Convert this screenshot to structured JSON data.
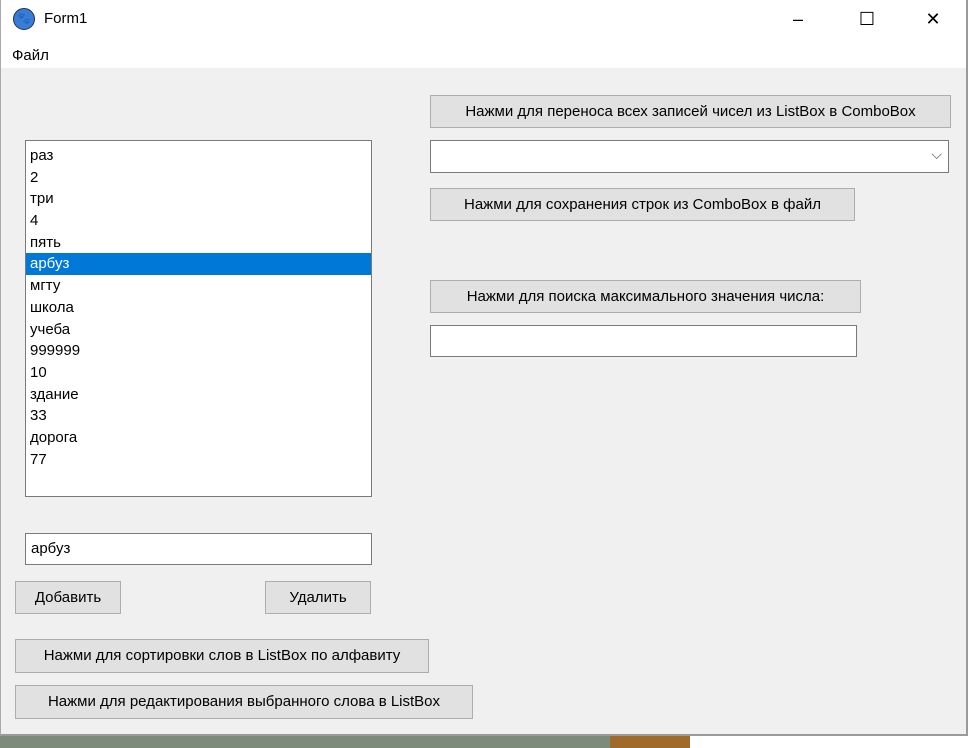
{
  "window": {
    "title": "Form1",
    "minimize": "–",
    "maximize": "☐",
    "close": "✕"
  },
  "menu": {
    "file": "Файл"
  },
  "listbox": {
    "items": [
      "раз",
      "2",
      "три",
      "4",
      "пять",
      "арбуз",
      "мгту",
      "школа",
      "учеба",
      "999999",
      "10",
      "здание",
      "33",
      "дорога",
      "77"
    ],
    "selected_index": 5
  },
  "textbox": {
    "value": "арбуз"
  },
  "buttons": {
    "add": "Добавить",
    "delete": "Удалить",
    "sort": "Нажми для сортировки слов в ListBox по алфавиту",
    "edit": "Нажми для редактирования выбранного слова в ListBox",
    "transfer": "Нажми для переноса всех записей чисел из ListBox в ComboBox",
    "save": "Нажми для сохранения строк из ComboBox в файл",
    "max": "Нажми для поиска максимального значения числа:"
  },
  "combobox": {
    "value": ""
  },
  "max_result": {
    "value": ""
  }
}
